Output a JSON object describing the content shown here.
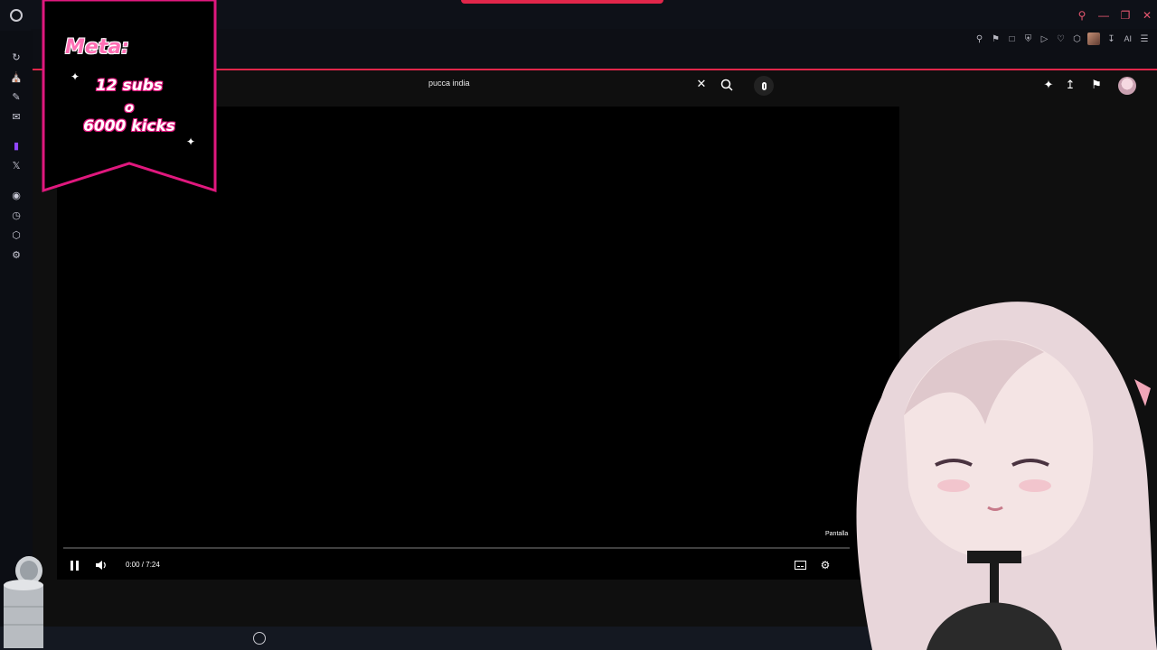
{
  "browser": {
    "window_controls": [
      "search-icon",
      "minimize-icon",
      "restore-icon",
      "close-icon"
    ],
    "toolbar_icons": [
      "zoom-icon",
      "pin-icon",
      "crop-icon",
      "shield-icon",
      "play-icon",
      "heart-icon",
      "extensions-icon",
      "extension-avatar",
      "download-icon",
      "ai-icon",
      "menu-icon"
    ],
    "ai_label": "AI",
    "accent_color": "#e1264a"
  },
  "sidebar": {
    "items": [
      "reload-icon",
      "shop-icon",
      "edit-icon",
      "mail-icon",
      "twitch-icon",
      "x-icon",
      "player-icon",
      "history-icon",
      "extensions-icon",
      "settings-icon"
    ]
  },
  "youtube": {
    "search": {
      "value": "pucca india"
    },
    "header_icons": [
      "create-icon",
      "upload-icon",
      "notifications-icon",
      "account-avatar"
    ]
  },
  "player": {
    "time": "0:00 / 7:24",
    "progress": 0.0,
    "tooltip": "Pantalla",
    "state": "playing"
  },
  "overlay": {
    "title": "Meta:",
    "line1": "12 subs",
    "line2": "o",
    "line3": "6000 kicks",
    "border_color": "#e0187e"
  }
}
